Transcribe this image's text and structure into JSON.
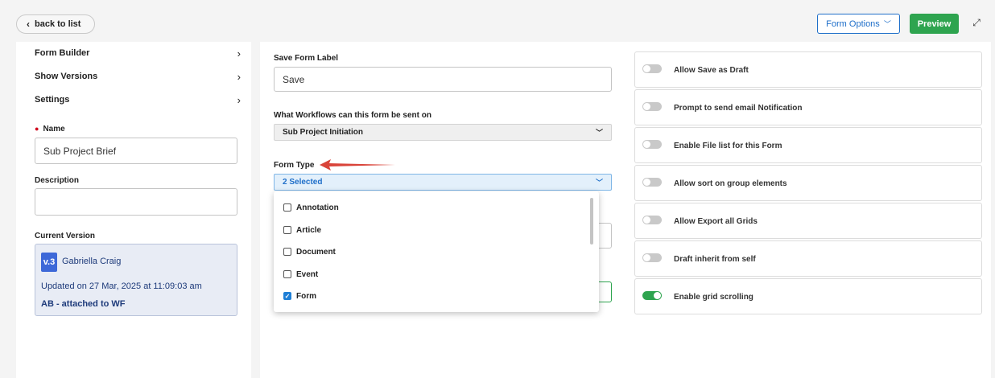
{
  "header": {
    "back_label": "back to list",
    "form_options_label": "Form Options",
    "preview_label": "Preview"
  },
  "sidebar": {
    "nav": [
      {
        "label": "Form Builder"
      },
      {
        "label": "Show Versions"
      },
      {
        "label": "Settings"
      }
    ],
    "name_label": "Name",
    "name_value": "Sub Project Brief",
    "description_label": "Description",
    "description_value": "",
    "current_version_label": "Current Version",
    "version": {
      "badge": "v.3",
      "author": "Gabriella Craig",
      "updated": "Updated on 27 Mar, 2025 at 11:09:03 am",
      "attached": "AB - attached to WF"
    }
  },
  "main": {
    "save_label_label": "Save Form Label",
    "save_label_value": "Save",
    "workflows_label": "What Workflows can this form be sent on",
    "workflows_value": "Sub Project Initiation",
    "form_type_label": "Form Type",
    "form_type_value": "2 Selected",
    "form_type_options": [
      {
        "label": "Annotation",
        "checked": false
      },
      {
        "label": "Article",
        "checked": false
      },
      {
        "label": "Document",
        "checked": false
      },
      {
        "label": "Event",
        "checked": false
      },
      {
        "label": "Form",
        "checked": true
      }
    ]
  },
  "toggles": [
    {
      "label": "Allow Save as Draft",
      "on": false
    },
    {
      "label": "Prompt to send email Notification",
      "on": false
    },
    {
      "label": "Enable File list for this Form",
      "on": false
    },
    {
      "label": "Allow sort on group elements",
      "on": false
    },
    {
      "label": "Allow Export all Grids",
      "on": false
    },
    {
      "label": "Draft inherit from self",
      "on": false
    },
    {
      "label": "Enable grid scrolling",
      "on": true
    }
  ],
  "colors": {
    "accent_blue": "#1f6fc9",
    "preview_green": "#2ea44f",
    "annotation_arrow": "#d9443a"
  }
}
